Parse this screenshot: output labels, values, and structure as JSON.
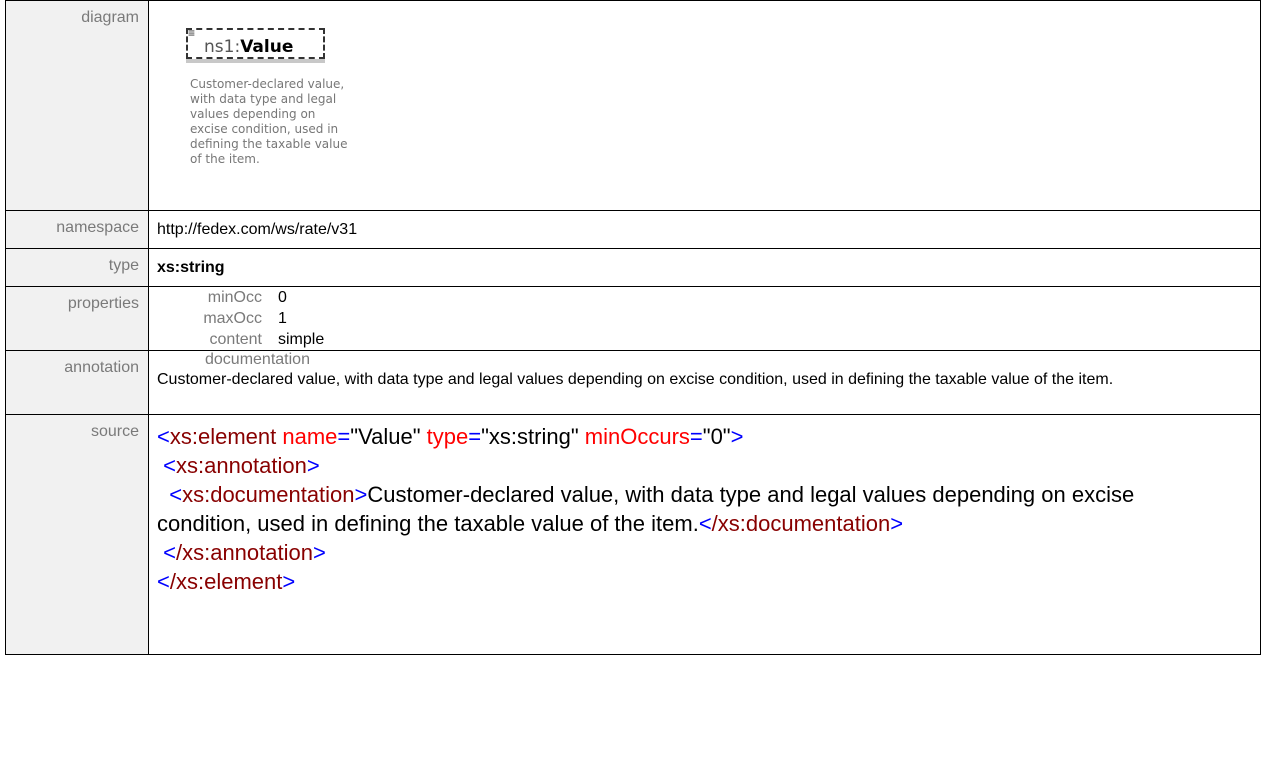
{
  "rows": {
    "diagram": {
      "label": "diagram",
      "element_prefix": "ns1:",
      "element_name": "Value",
      "description": "Customer-declared value, with data type and legal values depending on excise condition, used in defining the taxable value of the item."
    },
    "namespace": {
      "label": "namespace",
      "value": "http://fedex.com/ws/rate/v31"
    },
    "type": {
      "label": "type",
      "value": "xs:string"
    },
    "properties": {
      "label": "properties",
      "items": [
        {
          "key": "minOcc",
          "value": "0"
        },
        {
          "key": "maxOcc",
          "value": "1"
        },
        {
          "key": "content",
          "value": "simple"
        }
      ]
    },
    "annotation": {
      "label": "annotation",
      "heading": "documentation",
      "text": "Customer-declared value, with data type and legal values depending on excise condition, used in defining the taxable value of the item."
    },
    "source": {
      "label": "source",
      "line1_open": "<",
      "line1_tag": "xs:element",
      "attr1_name": "name",
      "attr1_value": "\"Value\"",
      "attr2_name": "type",
      "attr2_value": "\"xs:string\"",
      "attr3_name": "minOccurs",
      "attr3_value": "\"0\"",
      "close": ">",
      "annotation_open": "xs:annotation",
      "documentation_open": "xs:documentation",
      "documentation_text": "Customer-declared value, with data type and legal values depending on excise condition, used in defining the taxable value of the item.",
      "documentation_close": "/xs:documentation",
      "annotation_close": "/xs:annotation",
      "element_close": "/xs:element"
    }
  }
}
